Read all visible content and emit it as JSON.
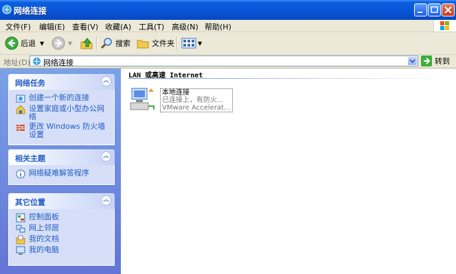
{
  "window": {
    "title": "网络连接"
  },
  "menu": [
    "文件(F)",
    "编辑(E)",
    "查看(V)",
    "收藏(A)",
    "工具(T)",
    "高级(N)",
    "帮助(H)"
  ],
  "toolbar": {
    "back": "后退",
    "search": "搜索",
    "folders": "文件夹"
  },
  "address": {
    "label": "地址(D)",
    "value": "网络连接",
    "go": "转到"
  },
  "panels": [
    {
      "title": "网络任务",
      "items": [
        "创建一个新的连接",
        "设置家庭或小型办公网络",
        "更改 Windows 防火墙设置"
      ]
    },
    {
      "title": "相关主题",
      "items": [
        "网络疑难解答程序"
      ]
    },
    {
      "title": "其它位置",
      "items": [
        "控制面板",
        "网上邻居",
        "我的文档",
        "我的电脑"
      ]
    }
  ],
  "content": {
    "group_title": "LAN 或高速 Internet",
    "connection": {
      "name": "本地连接",
      "status": "已连接上，有防火...",
      "device": "VMware Accelerat..."
    }
  },
  "colors": {
    "title_blue": "#0a54d6",
    "sidebar_blue": "#7ba2e7",
    "link_blue": "#215dc6"
  }
}
